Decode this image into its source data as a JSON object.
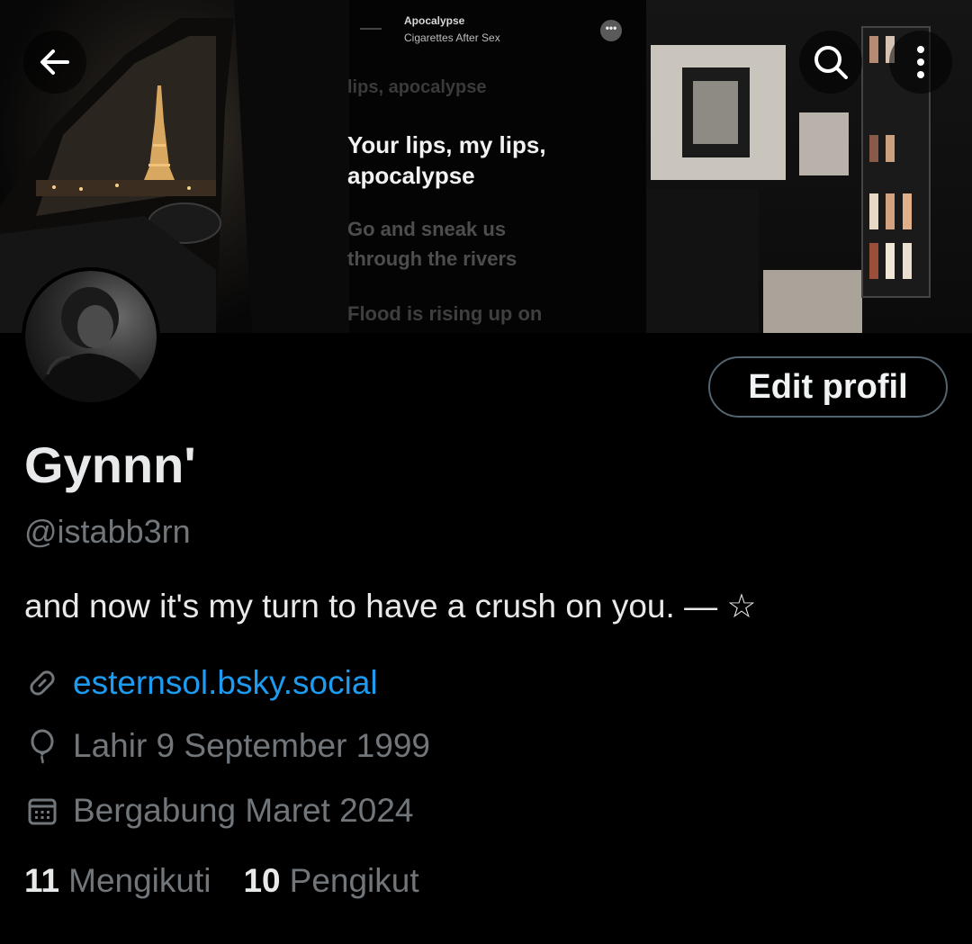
{
  "banner": {
    "music": {
      "song_title": "Apocalypse",
      "artist": "Cigarettes After Sex",
      "more_label": "•••"
    },
    "lyrics": {
      "previous": "lips, apocalypse",
      "current": "Your lips, my lips, apocalypse",
      "next": "Go and sneak us through the rivers",
      "next2": "Flood is rising up on"
    }
  },
  "header": {
    "back_icon": "arrow-left-icon",
    "search_icon": "search-icon",
    "more_icon": "more-vertical-icon"
  },
  "profile": {
    "edit_button_label": "Edit profil",
    "display_name": "Gynnn'",
    "handle": "@istabb3rn",
    "bio": "and now it's my turn to have a crush on you. — ☆",
    "website": "esternsol.bsky.social",
    "birthday": "Lahir 9 September 1999",
    "joined": "Bergabung Maret 2024"
  },
  "stats": {
    "following_count": "11",
    "following_label": "Mengikuti",
    "followers_count": "10",
    "followers_label": "Pengikut"
  },
  "colors": {
    "background": "#000000",
    "text_primary": "#e7e9ea",
    "text_secondary": "#71767b",
    "link": "#1d9bf0",
    "button_border": "#536471"
  }
}
